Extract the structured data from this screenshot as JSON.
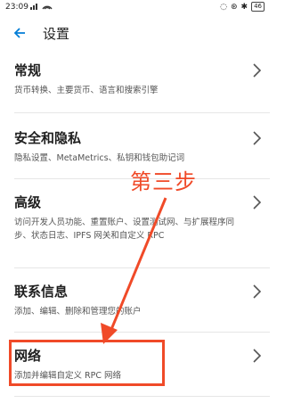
{
  "status_bar": {
    "time": "23:09",
    "signal_text": "5ıl",
    "battery_text": "46"
  },
  "header": {
    "title": "设置"
  },
  "items": [
    {
      "title": "常规",
      "desc": "货币转换、主要货币、语言和搜索引擎"
    },
    {
      "title": "安全和隐私",
      "desc": "隐私设置、MetaMetrics、私钥和钱包助记词"
    },
    {
      "title": "高级",
      "desc": "访问开发人员功能、重置账户、设置测试网、与扩展程序同步、状态日志、IPFS 网关和自定义 RPC"
    },
    {
      "title": "联系信息",
      "desc": "添加、编辑、删除和管理您的账户"
    },
    {
      "title": "网络",
      "desc": "添加并编辑自定义 RPC 网络"
    }
  ],
  "annotation": {
    "step_label": "第三步",
    "color": "#f04a28"
  },
  "colors": {
    "accent": "#037dd6",
    "highlight": "#f04a28"
  }
}
